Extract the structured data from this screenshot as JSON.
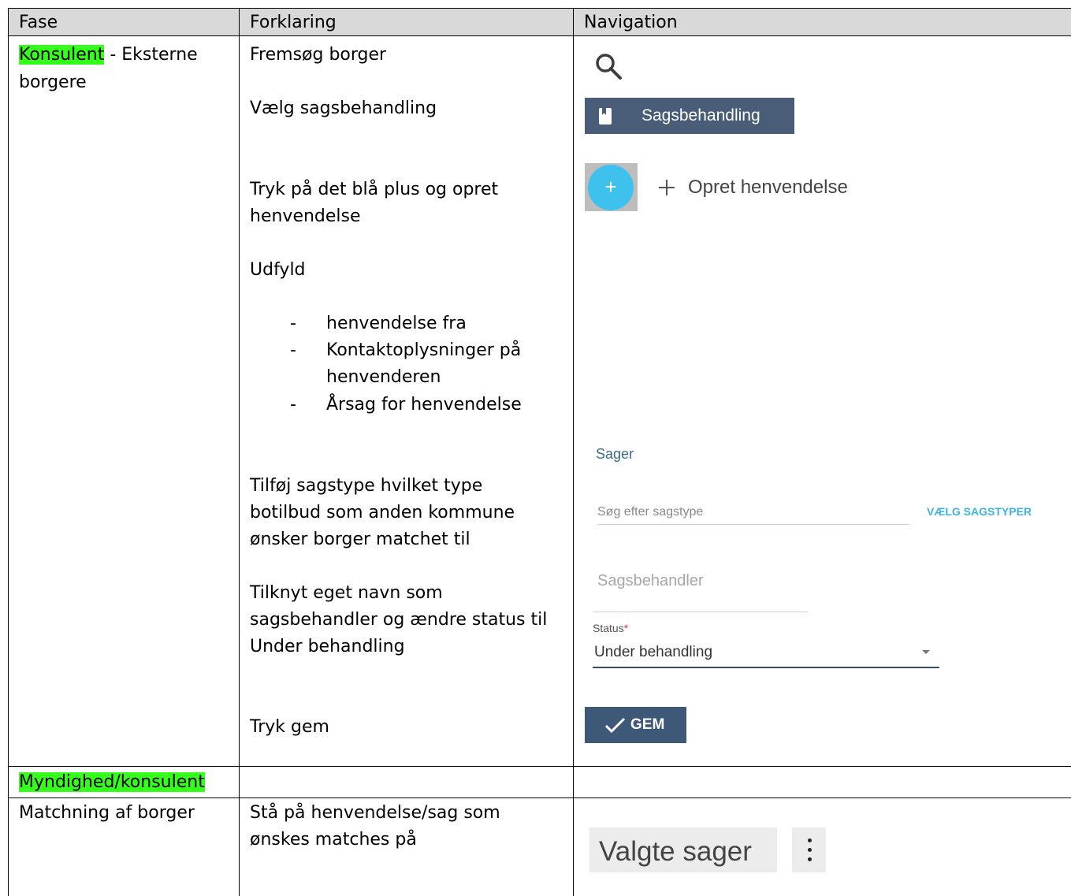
{
  "table": {
    "headers": [
      "Fase",
      "Forklaring",
      "Navigation"
    ],
    "row1": {
      "fase_highlight": "Konsulent",
      "fase_rest": " - Eksterne",
      "fase_line2": "borgere",
      "steps": {
        "fremsog": "Fremsøg borger",
        "vaelg": "Vælg sagsbehandling",
        "tryk_line1": "Tryk på det blå plus og opret",
        "tryk_line2": "henvendelse",
        "udfyld": "Udfyld",
        "bullets": [
          "henvendelse fra",
          "Kontaktoplysninger på",
          "henvenderen",
          "Årsag for henvendelse"
        ],
        "tilfoj": [
          "Tilføj sagstype hvilket type",
          "botilbud som anden kommune",
          "ønsker borger matchet til"
        ],
        "tilknyt": [
          "Tilknyt eget navn som",
          "sagsbehandler og ændre status til",
          "Under behandling"
        ],
        "gem": "Tryk gem"
      }
    },
    "row2": {
      "fase_highlight": "Myndighed/konsulent"
    },
    "row3": {
      "fase": "Matchning af borger",
      "forklaring": [
        "Stå på henvendelse/sag som",
        "ønskes matches på"
      ]
    }
  },
  "nav": {
    "sagsbehandling_label": "Sagsbehandling",
    "fab_plus": "+",
    "opret_label": "Opret henvendelse",
    "sager_label": "Sager",
    "sagstype_placeholder": "Søg efter sagstype",
    "vaelg_sagstyper": "VÆLG SAGSTYPER",
    "sagsbehandler_placeholder": "Sagsbehandler",
    "status_label": "Status",
    "status_required": "*",
    "status_value": "Under behandling",
    "gem_label": "GEM",
    "valgte_sager": "Valgte sager"
  },
  "colors": {
    "highlight": "#33ff1a",
    "header_bg": "#d9d9d9",
    "button_bg": "#4a5d78",
    "fab": "#3fc1ee",
    "link": "#3fb3e0"
  }
}
